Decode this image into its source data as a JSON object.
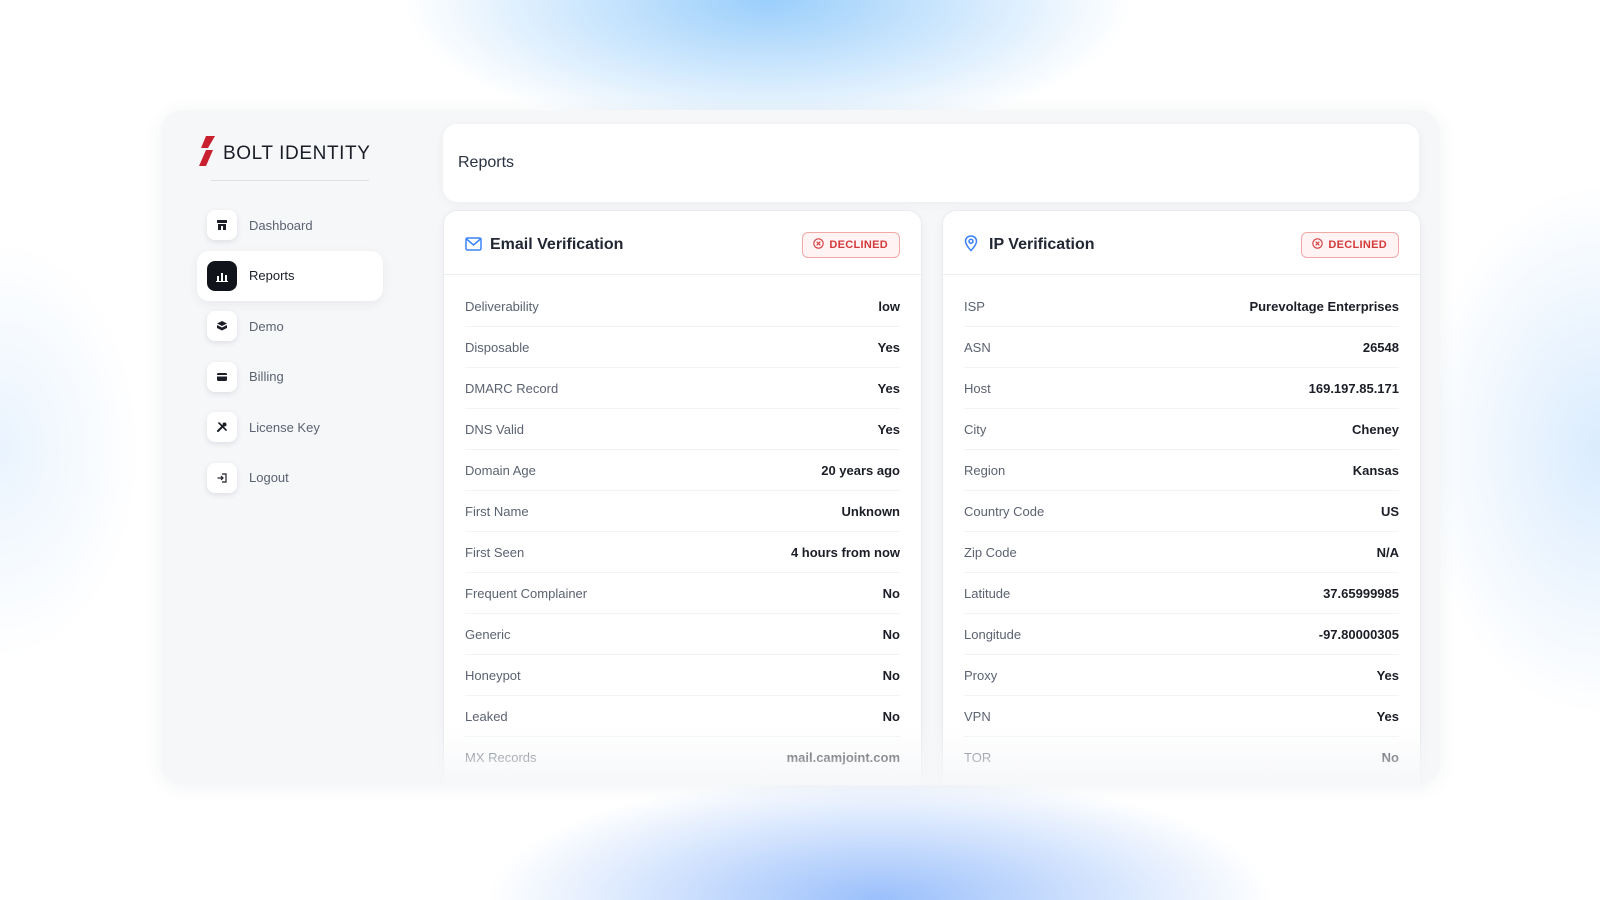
{
  "app": {
    "brand": "BOLT IDENTITY",
    "brand_color": "#c8202f"
  },
  "sidebar": {
    "items": [
      {
        "label": "Dashboard",
        "icon": "shop-icon",
        "active": false
      },
      {
        "label": "Reports",
        "icon": "chart-icon",
        "active": true
      },
      {
        "label": "Demo",
        "icon": "box-icon",
        "active": false
      },
      {
        "label": "Billing",
        "icon": "credit-card-icon",
        "active": false
      },
      {
        "label": "License Key",
        "icon": "tools-icon",
        "active": false
      },
      {
        "label": "Logout",
        "icon": "logout-icon",
        "active": false
      }
    ]
  },
  "header": {
    "title": "Reports"
  },
  "email_card": {
    "title": "Email Verification",
    "icon": "envelope-icon",
    "status": "DECLINED",
    "rows": [
      {
        "label": "Deliverability",
        "value": "low"
      },
      {
        "label": "Disposable",
        "value": "Yes"
      },
      {
        "label": "DMARC Record",
        "value": "Yes"
      },
      {
        "label": "DNS Valid",
        "value": "Yes"
      },
      {
        "label": "Domain Age",
        "value": "20 years ago"
      },
      {
        "label": "First Name",
        "value": "Unknown"
      },
      {
        "label": "First Seen",
        "value": "4 hours from now"
      },
      {
        "label": "Frequent Complainer",
        "value": "No"
      },
      {
        "label": "Generic",
        "value": "No"
      },
      {
        "label": "Honeypot",
        "value": "No"
      },
      {
        "label": "Leaked",
        "value": "No"
      },
      {
        "label": "MX Records",
        "value": "mail.camjoint.com"
      }
    ]
  },
  "ip_card": {
    "title": "IP Verification",
    "icon": "map-pin-icon",
    "status": "DECLINED",
    "rows": [
      {
        "label": "ISP",
        "value": "Purevoltage Enterprises"
      },
      {
        "label": "ASN",
        "value": "26548"
      },
      {
        "label": "Host",
        "value": "169.197.85.171"
      },
      {
        "label": "City",
        "value": "Cheney"
      },
      {
        "label": "Region",
        "value": "Kansas"
      },
      {
        "label": "Country Code",
        "value": "US"
      },
      {
        "label": "Zip Code",
        "value": "N/A"
      },
      {
        "label": "Latitude",
        "value": "37.65999985"
      },
      {
        "label": "Longitude",
        "value": "-97.80000305"
      },
      {
        "label": "Proxy",
        "value": "Yes"
      },
      {
        "label": "VPN",
        "value": "Yes"
      },
      {
        "label": "TOR",
        "value": "No"
      }
    ]
  },
  "colors": {
    "accent_blue": "#3b82f6",
    "declined_red": "#d33b3b",
    "active_nav": "#12141b"
  }
}
